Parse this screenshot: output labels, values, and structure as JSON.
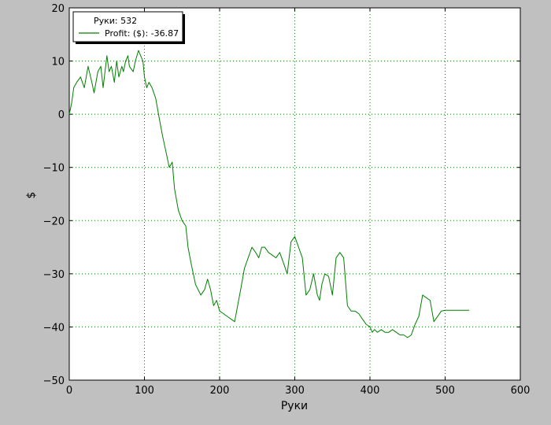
{
  "chart_data": {
    "type": "line",
    "title": "",
    "xlabel": "Руки",
    "ylabel": "$",
    "xlim": [
      0,
      600
    ],
    "ylim": [
      -50,
      20
    ],
    "xticks": [
      0,
      100,
      200,
      300,
      400,
      500,
      600
    ],
    "yticks": [
      -50,
      -40,
      -30,
      -20,
      -10,
      0,
      10,
      20
    ],
    "xtick_labels": [
      "0",
      "100",
      "200",
      "300",
      "400",
      "500",
      "600"
    ],
    "ytick_labels": [
      "−50",
      "−40",
      "−30",
      "−20",
      "−10",
      "0",
      "10",
      "20"
    ],
    "grid": true,
    "legend": {
      "placement": "top-left",
      "header": "Руки: 532",
      "entries": [
        "Profit: ($): -36.87"
      ]
    },
    "series": [
      {
        "name": "Profit: ($): -36.87",
        "color": "#008000",
        "x": [
          0,
          3,
          6,
          10,
          15,
          20,
          25,
          30,
          33,
          38,
          42,
          45,
          50,
          53,
          56,
          60,
          63,
          66,
          70,
          72,
          75,
          78,
          80,
          85,
          88,
          92,
          95,
          98,
          100,
          103,
          106,
          110,
          115,
          120,
          124,
          127,
          130,
          133,
          137,
          140,
          145,
          150,
          155,
          158,
          162,
          168,
          175,
          180,
          184,
          188,
          192,
          196,
          200,
          205,
          210,
          215,
          220,
          224,
          228,
          233,
          238,
          243,
          248,
          252,
          256,
          260,
          265,
          270,
          275,
          280,
          285,
          290,
          295,
          300,
          305,
          310,
          315,
          320,
          325,
          330,
          333,
          336,
          340,
          345,
          350,
          355,
          360,
          365,
          370,
          375,
          380,
          385,
          390,
          395,
          400,
          403,
          406,
          410,
          415,
          420,
          425,
          430,
          435,
          440,
          445,
          450,
          455,
          460,
          465,
          470,
          475,
          480,
          485,
          490,
          495,
          500,
          505,
          508,
          512,
          515,
          518,
          520,
          522,
          525,
          528,
          532
        ],
        "y": [
          0,
          2,
          5,
          6,
          7,
          5,
          9,
          6,
          4,
          8,
          9,
          5,
          11,
          8,
          9,
          6,
          10,
          7,
          9,
          8,
          10,
          11,
          9,
          8,
          10,
          12,
          11,
          10,
          7,
          5,
          6,
          5,
          3,
          -1,
          -4,
          -6,
          -8,
          -10,
          -9,
          -14,
          -18,
          -20,
          -21,
          -25,
          -28,
          -32,
          -34,
          -33,
          -31,
          -33,
          -36,
          -35,
          -37,
          -37.5,
          -38,
          -38.5,
          -39,
          -36,
          -33,
          -29,
          -27,
          -25,
          -26,
          -27,
          -25,
          -25,
          -26,
          -26.5,
          -27,
          -26,
          -28,
          -30,
          -24,
          -23,
          -25,
          -27,
          -34,
          -33,
          -30,
          -34,
          -35,
          -32,
          -30,
          -30.5,
          -34,
          -27,
          -26,
          -27,
          -36,
          -37,
          -37,
          -37.5,
          -38.5,
          -39.5,
          -40,
          -41,
          -40.5,
          -41,
          -40.5,
          -41,
          -41,
          -40.5,
          -41,
          -41.5,
          -41.5,
          -42,
          -41.5,
          -39.5,
          -38,
          -34,
          -34.5,
          -35,
          -39,
          -38,
          -37,
          -36.87,
          -36.87,
          -36.87,
          -36.87,
          -36.87,
          -36.87,
          -36.87,
          -36.87,
          -36.87,
          -36.87,
          -36.87
        ]
      }
    ]
  }
}
